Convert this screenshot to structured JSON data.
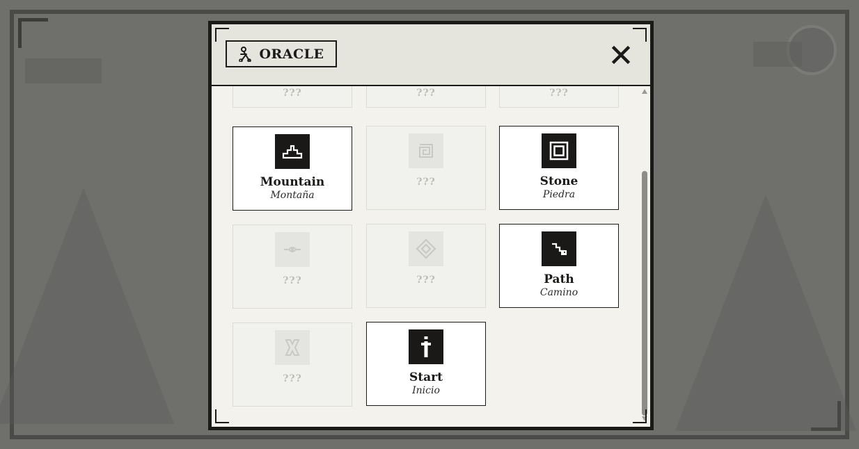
{
  "modal": {
    "title": "ORACLE",
    "title_icon": "oracle-figure-icon",
    "close_icon": "close-icon"
  },
  "glossary": {
    "items": [
      {
        "state": "unknown",
        "placeholder": "???"
      },
      {
        "state": "unknown",
        "placeholder": "???"
      },
      {
        "state": "unknown",
        "placeholder": "???"
      },
      {
        "state": "known",
        "name": "Mountain",
        "translation": "Montaña",
        "icon": "mountain-glyph-icon"
      },
      {
        "state": "unknown",
        "placeholder": "???",
        "icon": "spiral-glyph-icon"
      },
      {
        "state": "known",
        "name": "Stone",
        "translation": "Piedra",
        "icon": "stone-glyph-icon"
      },
      {
        "state": "unknown",
        "placeholder": "???",
        "icon": "eye-glyph-icon"
      },
      {
        "state": "unknown",
        "placeholder": "???",
        "icon": "diamond-glyph-icon"
      },
      {
        "state": "known",
        "name": "Path",
        "translation": "Camino",
        "icon": "path-glyph-icon"
      },
      {
        "state": "unknown",
        "placeholder": "???",
        "icon": "hourglass-glyph-icon"
      },
      {
        "state": "known",
        "name": "Start",
        "translation": "Inicio",
        "icon": "start-glyph-icon"
      }
    ]
  },
  "colors": {
    "ink": "#1a1a19",
    "panel": "#f3f2ec",
    "header": "#e6e5dd",
    "locked_text": "#bdbdb8"
  }
}
